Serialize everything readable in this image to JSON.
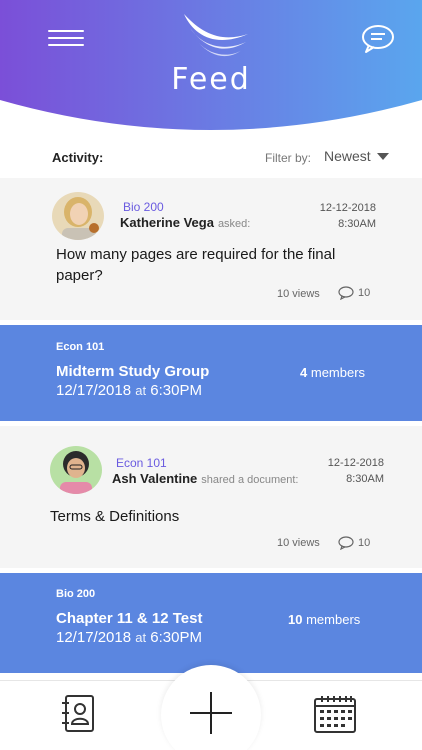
{
  "header": {
    "title": "Feed",
    "gradient_start": "#7b4fd8",
    "gradient_end": "#5aa6ee",
    "menu_icon": "hamburger-icon",
    "logo": "wing-logo",
    "chat_icon": "chat-bubble-icon"
  },
  "activity": {
    "label": "Activity:",
    "filter_label": "Filter by:",
    "filter_value": "Newest"
  },
  "feed": {
    "q1": {
      "course": "Bio 200",
      "author": "Katherine Vega",
      "action": "asked:",
      "date": "12-12-2018",
      "time": "8:30AM",
      "text": "How many pages are required for the final paper?",
      "views": "10 views",
      "comments": "10"
    },
    "e1": {
      "course": "Econ 101",
      "title": "Midterm Study Group",
      "date": "12/17/2018",
      "at": "at",
      "time": "6:30PM",
      "members_count": "4",
      "members_label": "members"
    },
    "q2": {
      "course": "Econ 101",
      "author": "Ash Valentine",
      "action": "shared a document:",
      "date": "12-12-2018",
      "time": "8:30AM",
      "text": "Terms & Definitions",
      "views": "10 views",
      "comments": "10"
    },
    "e2": {
      "course": "Bio 200",
      "title": "Chapter 11 & 12 Test",
      "date": "12/17/2018",
      "at": "at",
      "time": "6:30PM",
      "members_count": "10",
      "members_label": "members"
    }
  },
  "bottom_nav": {
    "contacts_icon": "contacts-book-icon",
    "add_icon": "plus-icon",
    "calendar_icon": "calendar-icon"
  },
  "colors": {
    "accent_purple": "#6a5be0",
    "event_blue": "#5b86e0",
    "card_gray": "#f5f5f5"
  }
}
